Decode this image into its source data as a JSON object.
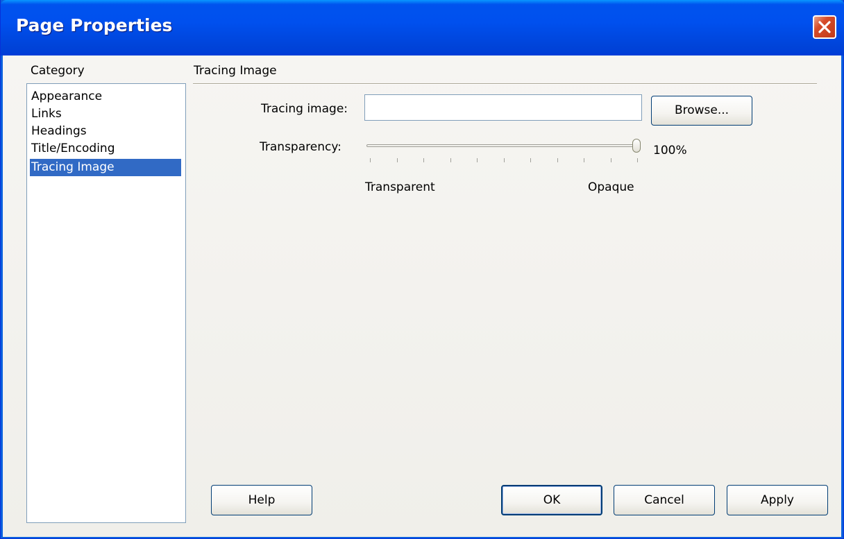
{
  "window": {
    "title": "Page Properties",
    "close_icon": "close-icon"
  },
  "sidebar": {
    "label": "Category",
    "items": [
      {
        "label": "Appearance",
        "selected": false
      },
      {
        "label": "Links",
        "selected": false
      },
      {
        "label": "Headings",
        "selected": false
      },
      {
        "label": "Title/Encoding",
        "selected": false
      },
      {
        "label": "Tracing Image",
        "selected": true
      }
    ]
  },
  "main": {
    "section_title": "Tracing Image",
    "tracing_image": {
      "label": "Tracing image:",
      "value": "",
      "browse_label": "Browse..."
    },
    "transparency": {
      "label": "Transparency:",
      "value_text": "100%",
      "level_percent": 100,
      "min_label": "Transparent",
      "max_label": "Opaque"
    }
  },
  "footer": {
    "help_label": "Help",
    "ok_label": "OK",
    "cancel_label": "Cancel",
    "apply_label": "Apply"
  },
  "colors": {
    "titlebar": "#0053ee",
    "selection": "#316ac5",
    "close_button": "#d74c2a"
  }
}
